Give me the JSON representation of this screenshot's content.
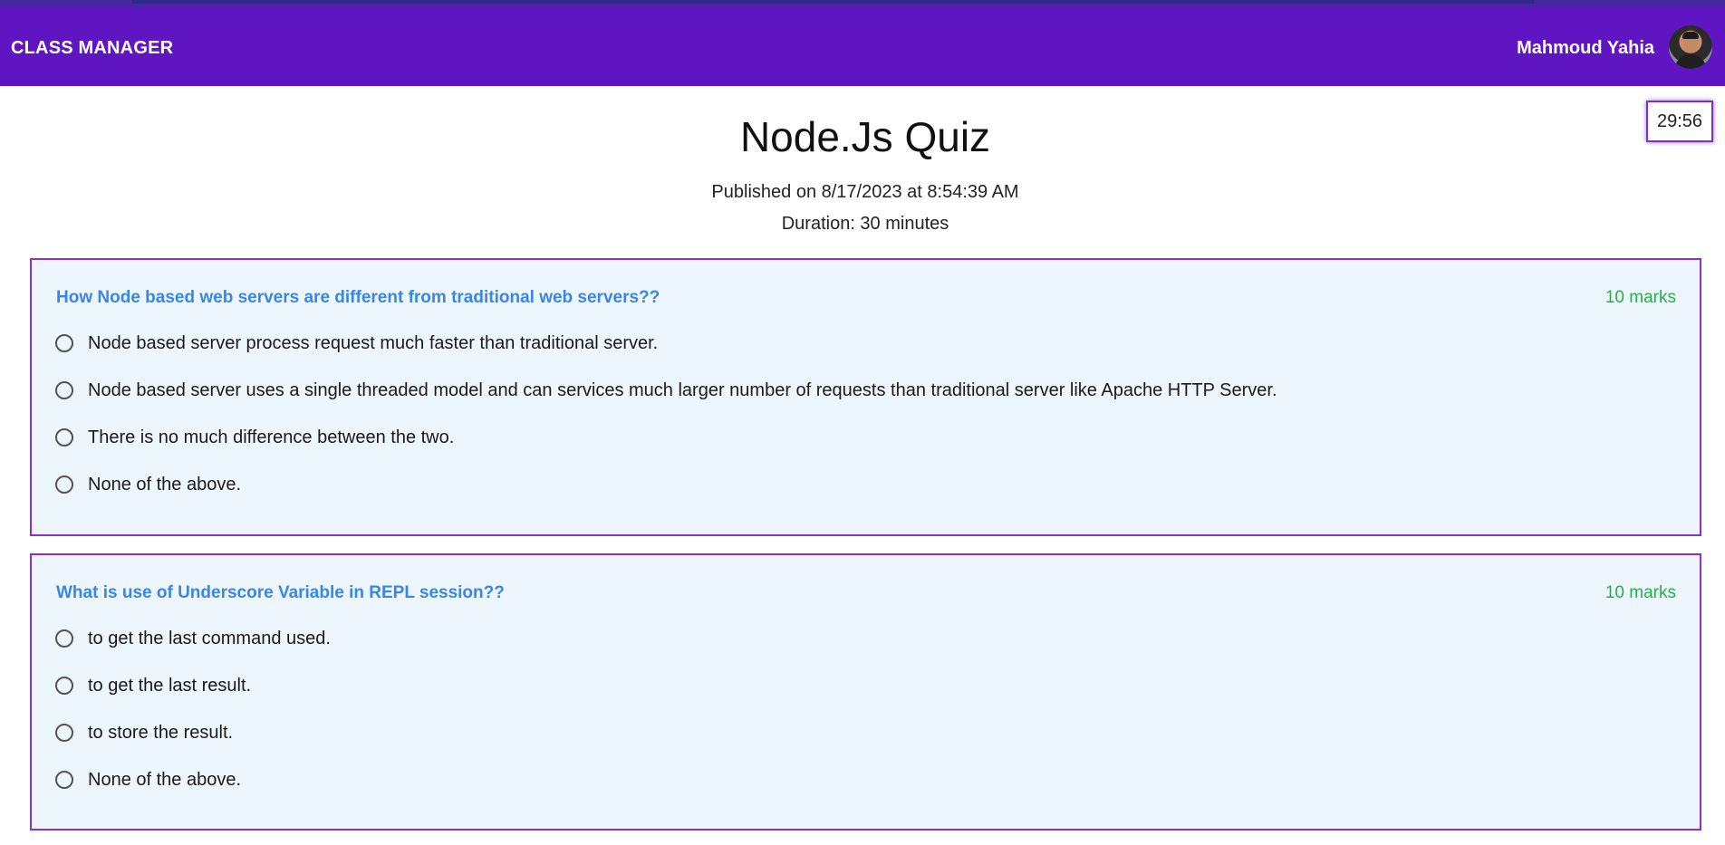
{
  "header": {
    "brand": "CLASS MANAGER",
    "user_name": "Mahmoud Yahia",
    "avatar_icon": "user-avatar",
    "colors": {
      "appbar": "#5f16c2",
      "accent": "#7a2fd6"
    }
  },
  "timer": {
    "value": "29:56"
  },
  "quiz": {
    "title": "Node.Js Quiz",
    "published": "Published on 8/17/2023 at 8:54:39 AM",
    "duration": "Duration: 30 minutes"
  },
  "questions": [
    {
      "text": "How Node based web servers are different from traditional web servers??",
      "marks": "10 marks",
      "options": [
        "Node based server process request much faster than traditional server.",
        "Node based server uses a single threaded model and can services much larger number of requests than traditional server like Apache HTTP Server.",
        "There is no much difference between the two.",
        "None of the above."
      ]
    },
    {
      "text": "What is use of Underscore Variable in REPL session??",
      "marks": "10 marks",
      "options": [
        "to get the last command used.",
        "to get the last result.",
        "to store the result.",
        "None of the above."
      ]
    }
  ]
}
